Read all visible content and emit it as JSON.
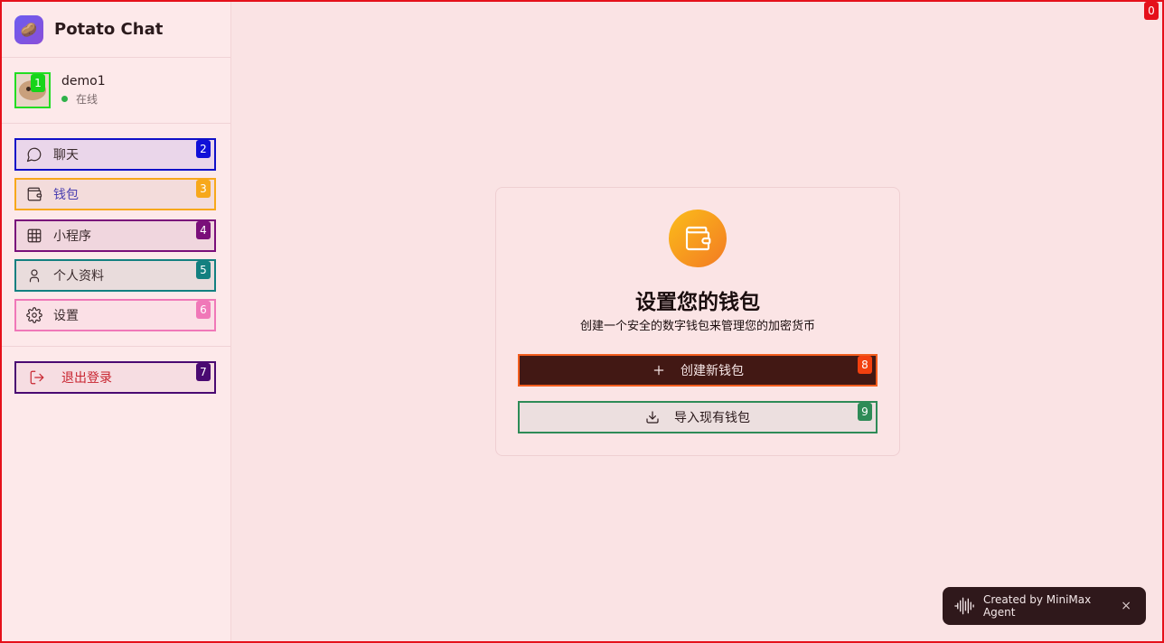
{
  "app": {
    "name": "Potato Chat",
    "logo_emoji": "🥔"
  },
  "user": {
    "name": "demo1",
    "status": "在线",
    "status_color": "#2fb14a"
  },
  "nav": {
    "items": [
      {
        "label": "聊天",
        "icon": "chat-icon"
      },
      {
        "label": "钱包",
        "icon": "wallet-icon"
      },
      {
        "label": "小程序",
        "icon": "grid-icon"
      },
      {
        "label": "个人资料",
        "icon": "user-icon"
      },
      {
        "label": "设置",
        "icon": "gear-icon"
      }
    ],
    "logout": {
      "label": "退出登录",
      "icon": "logout-icon",
      "color": "#c8242f"
    }
  },
  "wallet_setup": {
    "title": "设置您的钱包",
    "subtitle": "创建一个安全的数字钱包来管理您的加密货币",
    "create_label": "创建新钱包",
    "import_label": "导入现有钱包"
  },
  "toast": {
    "text": "Created by MiniMax Agent",
    "close": "×"
  },
  "markers": [
    "0",
    "1",
    "2",
    "3",
    "4",
    "5",
    "6",
    "7",
    "8",
    "9"
  ],
  "colors": {
    "accent_primary_button": "#421814",
    "wallet_gradient_start": "#fbbd1a",
    "wallet_gradient_end": "#f37a23"
  }
}
